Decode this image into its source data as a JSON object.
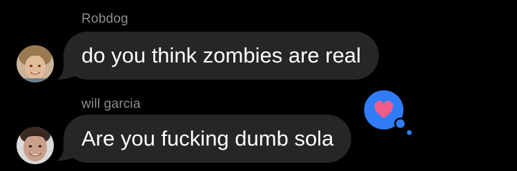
{
  "messages": [
    {
      "sender": "Robdog",
      "text": "do you think zombies are real"
    },
    {
      "sender": "will garcia",
      "text": "Are you fucking dumb sola",
      "reaction": "heart"
    }
  ],
  "icons": {
    "reaction": "heart-icon"
  },
  "colors": {
    "background": "#000000",
    "bubble": "#262629",
    "sender_name": "#8e8e93",
    "message_text": "#ffffff",
    "reaction_bubble": "#2f7cf6",
    "reaction_heart": "#f25c8a"
  }
}
